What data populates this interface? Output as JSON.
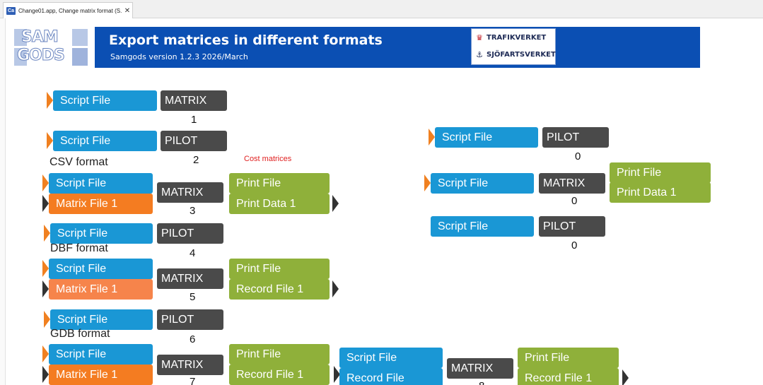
{
  "tab": {
    "title": "Change01.app, Change matrix format (S...",
    "close": "✕",
    "icon": "Ca"
  },
  "banner": {
    "logo_top": "SAM",
    "logo_bottom": "GODS",
    "title": "Export matrices in different formats",
    "subtitle": "Samgods version 1.2.3 2026/March",
    "partner1": "TRAFIKVERKET",
    "partner2": "SJÖFARTSVERKET"
  },
  "blocks": {
    "script_file": "Script File",
    "matrix": "MATRIX",
    "pilot": "PILOT",
    "matrix_file_1": "Matrix File 1",
    "print_file": "Print File",
    "print_data_1": "Print Data 1",
    "record_file_1": "Record File 1",
    "record_file": "Record File"
  },
  "labels": {
    "csv": "CSV format",
    "dbf": "DBF format",
    "gdb": "GDB format",
    "cost": "Cost matrices"
  },
  "numbers": {
    "n1": "1",
    "n2": "2",
    "n3": "3",
    "n4": "4",
    "n5": "5",
    "n6": "6",
    "n7": "7",
    "n8": "8",
    "r0a": "0",
    "r0b": "0",
    "r0c": "0"
  },
  "colors": {
    "banner": "#0b4fb3",
    "script_blue": "#1a97d5",
    "matrix_dark": "#4a4a4a",
    "print_green": "#8fb03a",
    "matrix_file_orange": "#f47c21"
  }
}
